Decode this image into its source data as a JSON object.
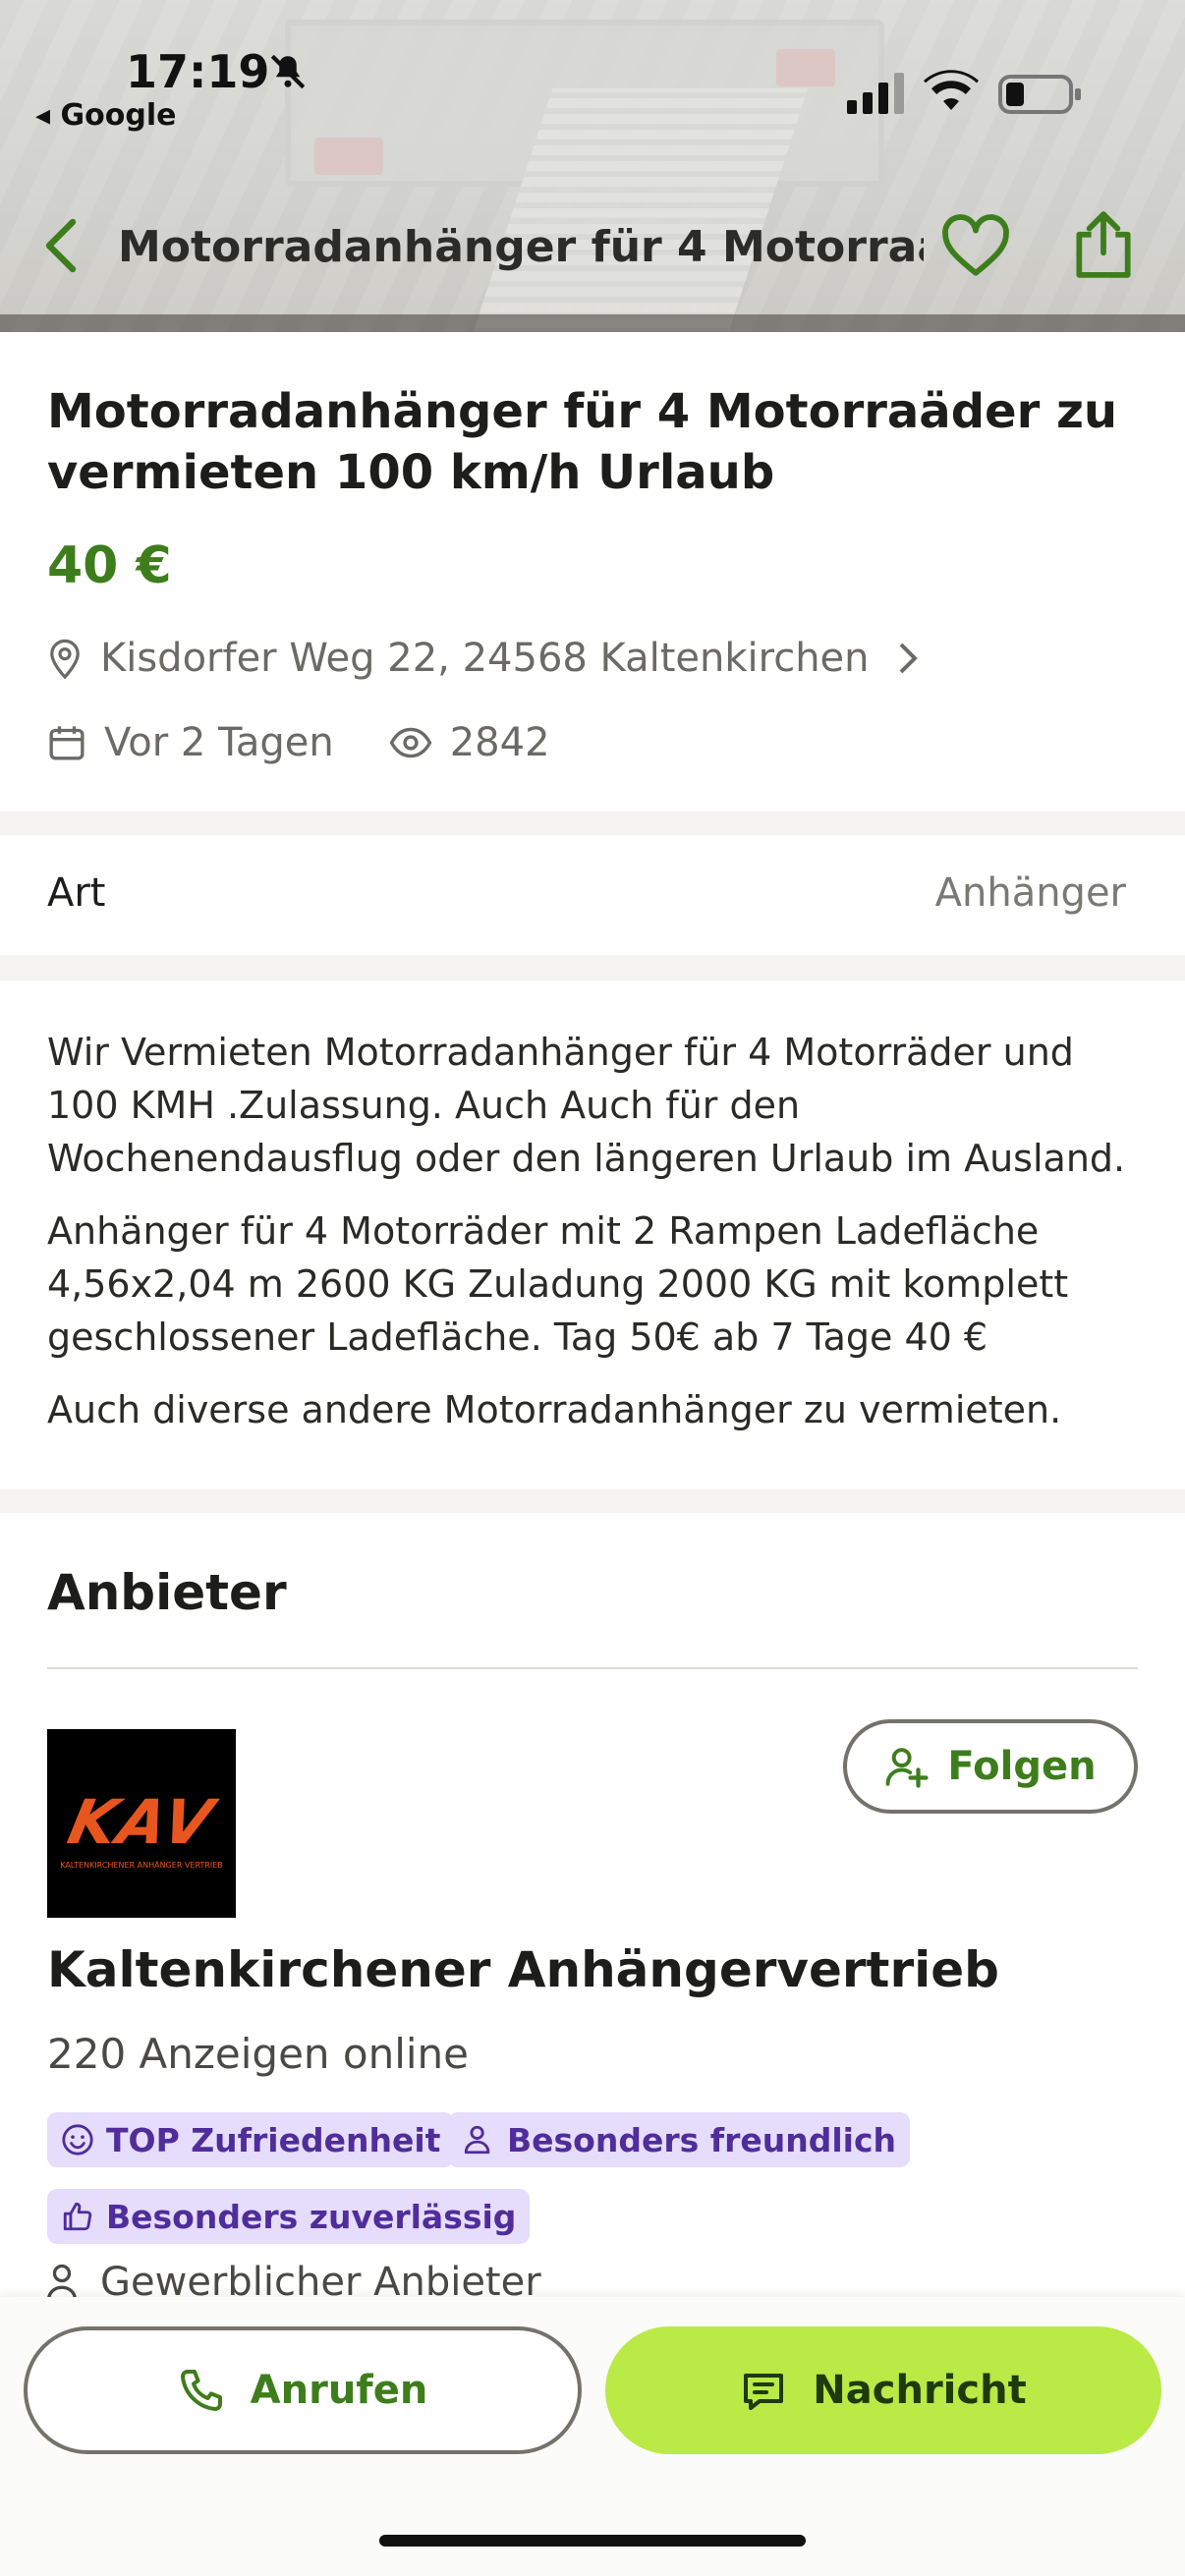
{
  "status_bar": {
    "time": "17:19",
    "back_app": "◂ Google"
  },
  "nav": {
    "title": "Motorradanhänger für 4 Motorraä..."
  },
  "ad": {
    "title": "Motorradanhänger für 4 Motorraäder zu vermieten 100 km/h Urlaub",
    "price": "40 €",
    "location": "Kisdorfer Weg 22, 24568 Kaltenkirchen",
    "posted": "Vor 2 Tagen",
    "views": "2842"
  },
  "attributes": {
    "art_label": "Art",
    "art_value": "Anhänger"
  },
  "description": {
    "p1": "Wir Vermieten Motorradanhänger für 4 Motorräder und 100 KMH .Zulassung. Auch Auch für den Wochenendausflug oder den längeren Urlaub im Ausland.",
    "p2": "Anhänger für 4 Motorräder mit 2 Rampen Ladefläche 4,56x2,04 m 2600 KG Zuladung 2000 KG mit komplett geschlossener Ladefläche. Tag 50€ ab 7 Tage 40 €",
    "p3": "Auch diverse andere Motorradanhänger zu vermieten."
  },
  "seller": {
    "heading": "Anbieter",
    "logo_text": "KAV",
    "logo_subtext": "KALTENKIRCHENER ANHÄNGER VERTRIEB",
    "follow_label": "Folgen",
    "name": "Kaltenkirchener Anhängervertrieb",
    "ads_online": "220 Anzeigen online",
    "badges": [
      "TOP Zufriedenheit",
      "Besonders freundlich",
      "Besonders zuverlässig"
    ],
    "type": "Gewerblicher Anbieter"
  },
  "actions": {
    "call_label": "Anrufen",
    "message_label": "Nachricht"
  },
  "colors": {
    "accent_green": "#3e7d1b",
    "button_lime": "#b9ea45",
    "badge_bg": "#e6dcfb",
    "badge_text": "#4f2d9a",
    "logo_orange": "#e8561f"
  },
  "icons": {
    "bell": "bell-slash-icon",
    "back": "chevron-left-icon",
    "favorite": "heart-icon",
    "share": "share-icon",
    "location": "map-pin-icon",
    "date": "calendar-icon",
    "views": "eye-icon",
    "follow": "user-plus-icon",
    "call": "phone-icon",
    "message": "message-icon"
  }
}
